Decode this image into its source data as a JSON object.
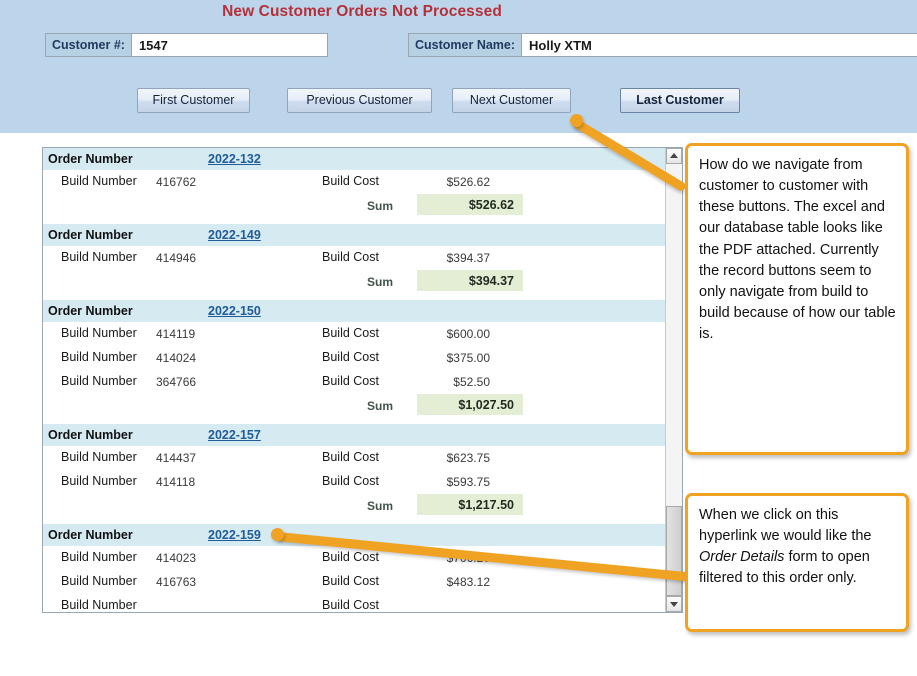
{
  "form": {
    "title": "New Customer Orders Not Processed",
    "accent_blue": "#bcd5ea",
    "title_color": "#b5303a",
    "callout_border": "#f0a322",
    "link_color": "#1f5c99",
    "order_header_bg": "#d6eaf2",
    "sum_chip_bg": "#e4eed5"
  },
  "fields": {
    "customer_number": {
      "label": "Customer #:",
      "value": "1547",
      "placeholder": ""
    },
    "customer_name": {
      "label": "Customer Name:",
      "value": "Holly XTM",
      "placeholder": ""
    }
  },
  "nav_buttons": [
    {
      "label": "First Customer"
    },
    {
      "label": "Previous Customer"
    },
    {
      "label": "Next Customer"
    },
    {
      "label": "Last Customer"
    }
  ],
  "subform": {
    "order_label": "Order Number",
    "build_number_label": "Build Number",
    "build_cost_label": "Build Cost",
    "sum_label": "Sum",
    "orders": [
      {
        "order_number": "2022-132",
        "builds": [
          {
            "build_number": "416762",
            "build_cost": "$526.62"
          }
        ],
        "sum": "$526.62"
      },
      {
        "order_number": "2022-149",
        "builds": [
          {
            "build_number": "414946",
            "build_cost": "$394.37"
          }
        ],
        "sum": "$394.37"
      },
      {
        "order_number": "2022-150",
        "builds": [
          {
            "build_number": "414119",
            "build_cost": "$600.00"
          },
          {
            "build_number": "414024",
            "build_cost": "$375.00"
          },
          {
            "build_number": "364766",
            "build_cost": "$52.50"
          }
        ],
        "sum": "$1,027.50"
      },
      {
        "order_number": "2022-157",
        "builds": [
          {
            "build_number": "414437",
            "build_cost": "$623.75"
          },
          {
            "build_number": "414118",
            "build_cost": "$593.75"
          }
        ],
        "sum": "$1,217.50"
      },
      {
        "order_number": "2022-159",
        "builds": [
          {
            "build_number": "414023",
            "build_cost": "$706.25"
          },
          {
            "build_number": "416763",
            "build_cost": "$483.12"
          },
          {
            "build_number": "",
            "build_cost": ""
          }
        ],
        "sum": ""
      }
    ]
  },
  "callouts": {
    "navigation": "How do we navigate from customer to customer with these buttons. The excel and our database table looks like the PDF attached. Currently the record buttons seem to only navigate from build to build because of how our table is.",
    "hyperlink_part1": "When we click on this hyperlink we would like the ",
    "hyperlink_emphasis": "Order Details",
    "hyperlink_part2": " form to open filtered to this order only."
  }
}
